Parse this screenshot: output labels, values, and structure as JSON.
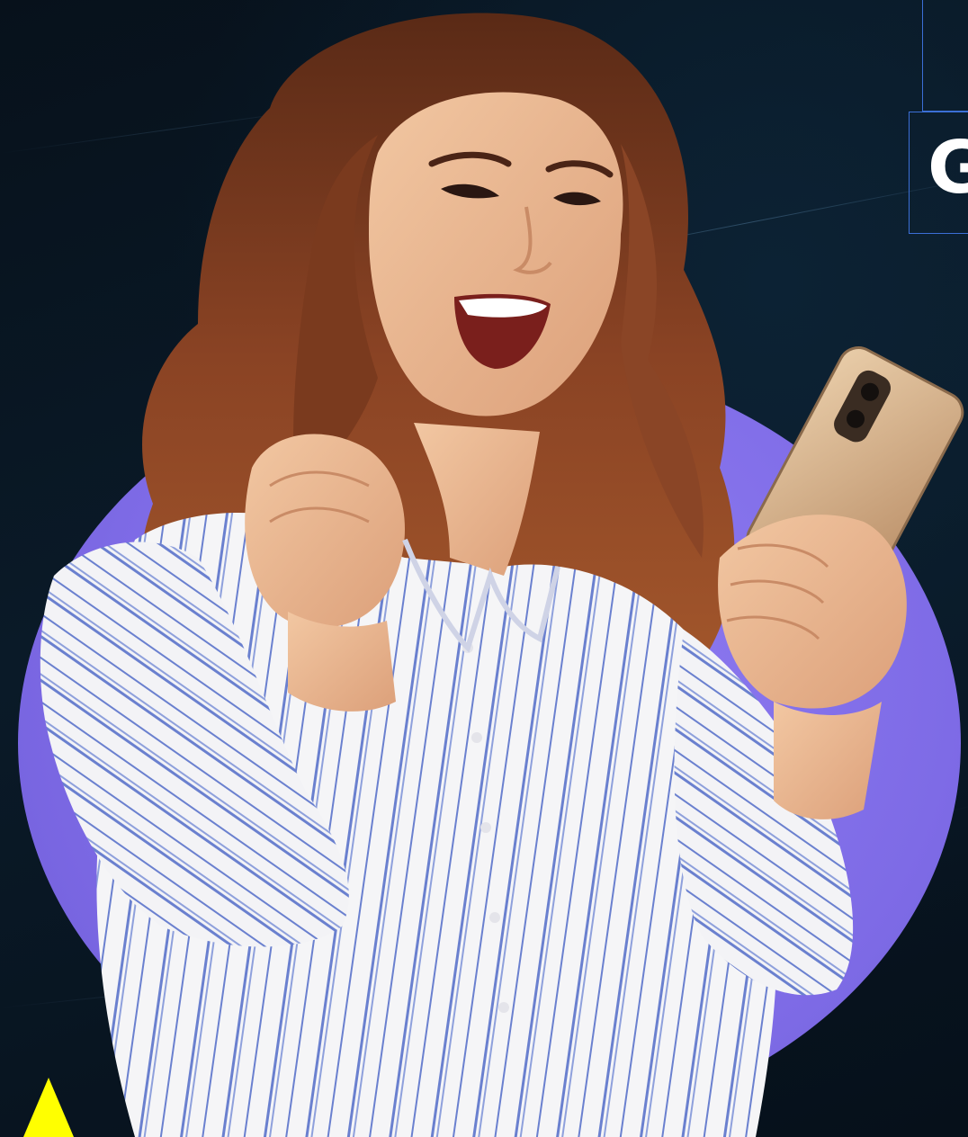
{
  "heading": {
    "text": "G"
  },
  "colors": {
    "background": "#07111b",
    "circle": "#8674ee",
    "frame_border": "#3b6fd6",
    "heading_text": "#ffffff",
    "arrow": "#ffff00",
    "shirt": "#f4f4f6",
    "shirt_stripes": "#5b72c4",
    "hair": "#7a3a1e",
    "skin": "#e9b893",
    "phone": "#d8b48e"
  },
  "image": {
    "subject": "woman-with-phone-photo"
  },
  "icons": {
    "arrow": "up-arrow-icon"
  }
}
